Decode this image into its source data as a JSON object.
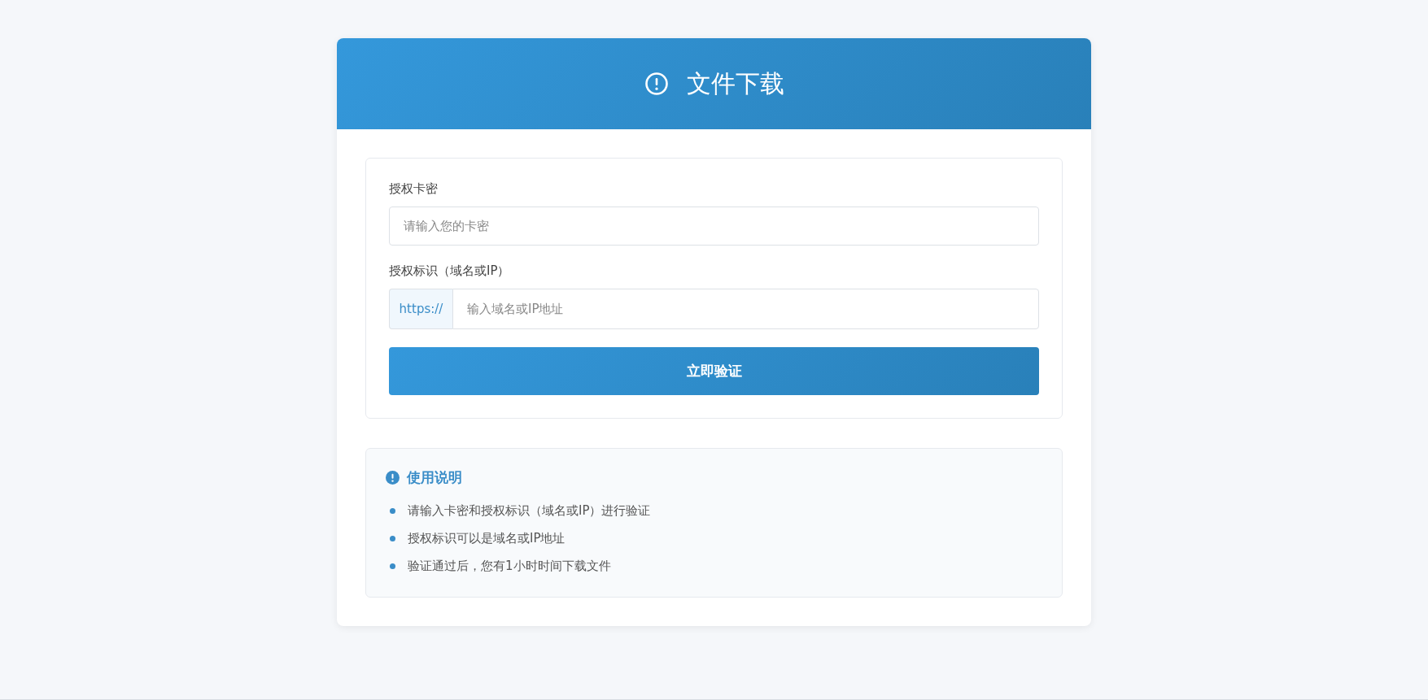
{
  "header": {
    "title": "文件下载"
  },
  "form": {
    "fields": [
      {
        "kind": "plain",
        "label": "授权卡密",
        "placeholder": "请输入您的卡密"
      },
      {
        "kind": "prefixed",
        "label": "授权标识（域名或IP）",
        "prefix": "https://",
        "placeholder": "输入域名或IP地址"
      }
    ],
    "submit": "立即验证"
  },
  "instructions": {
    "title": "使用说明",
    "items": [
      "请输入卡密和授权标识（域名或IP）进行验证",
      "授权标识可以是域名或IP地址",
      "验证通过后，您有1小时时间下载文件"
    ]
  }
}
